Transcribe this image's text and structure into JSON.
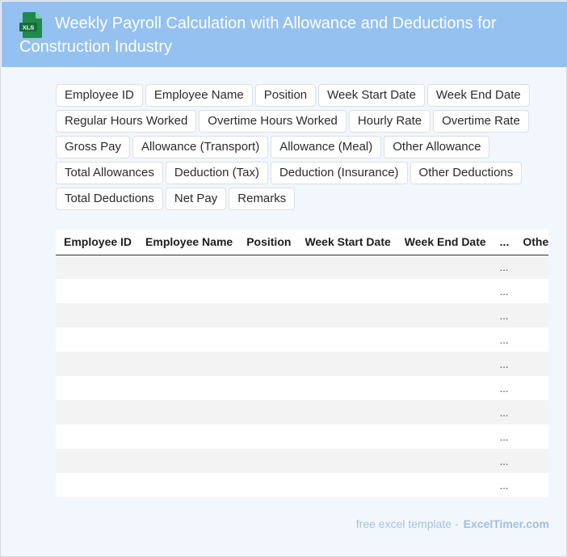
{
  "header": {
    "title": "Weekly Payroll Calculation with Allowance and Deductions for Construction Industry",
    "icon": "excel-file-icon",
    "icon_label": "XLS",
    "icon_color": "#1e8a4c"
  },
  "fields": [
    "Employee ID",
    "Employee Name",
    "Position",
    "Week Start Date",
    "Week End Date",
    "Regular Hours Worked",
    "Overtime Hours Worked",
    "Hourly Rate",
    "Overtime Rate",
    "Gross Pay",
    "Allowance (Transport)",
    "Allowance (Meal)",
    "Other Allowance",
    "Total Allowances",
    "Deduction (Tax)",
    "Deduction (Insurance)",
    "Other Deductions",
    "Total Deductions",
    "Net Pay",
    "Remarks"
  ],
  "table": {
    "columns": [
      "Employee ID",
      "Employee Name",
      "Position",
      "Week Start Date",
      "Week End Date",
      "...",
      "Other Deductions"
    ],
    "rows": [
      [
        "",
        "",
        "",
        "",
        "",
        "...",
        ""
      ],
      [
        "",
        "",
        "",
        "",
        "",
        "...",
        ""
      ],
      [
        "",
        "",
        "",
        "",
        "",
        "...",
        ""
      ],
      [
        "",
        "",
        "",
        "",
        "",
        "...",
        ""
      ],
      [
        "",
        "",
        "",
        "",
        "",
        "...",
        ""
      ],
      [
        "",
        "",
        "",
        "",
        "",
        "...",
        ""
      ],
      [
        "",
        "",
        "",
        "",
        "",
        "...",
        ""
      ],
      [
        "",
        "",
        "",
        "",
        "",
        "...",
        ""
      ],
      [
        "",
        "",
        "",
        "",
        "",
        "...",
        ""
      ],
      [
        "",
        "",
        "",
        "",
        "",
        "...",
        ""
      ]
    ]
  },
  "footer": {
    "text": "free excel template -",
    "brand": "ExcelTimer.com"
  },
  "colors": {
    "header_bg": "#94c1f0",
    "page_bg": "#f2f7fe",
    "row_stripe": "#f3f3f3"
  }
}
